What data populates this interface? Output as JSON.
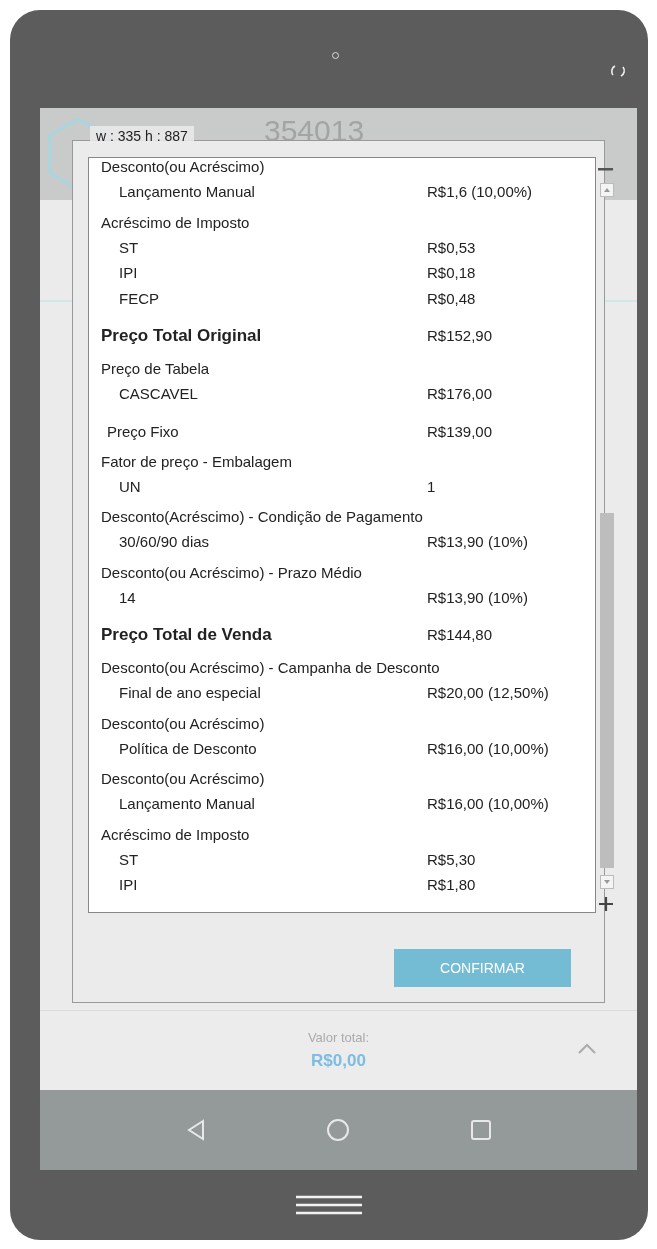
{
  "overlay_label": "w : 335  h : 887",
  "header": {
    "title": "354013"
  },
  "breakdown": [
    {
      "kind": "group",
      "title": "Desconto(ou Acréscimo)",
      "rows": [
        {
          "label": "Lançamento Manual",
          "value": "R$1,6 (10,00%)"
        }
      ]
    },
    {
      "kind": "group",
      "title": "Acréscimo de Imposto",
      "rows": [
        {
          "label": "ST",
          "value": "R$0,53"
        },
        {
          "label": "IPI",
          "value": "R$0,18"
        },
        {
          "label": "FECP",
          "value": "R$0,48"
        }
      ]
    },
    {
      "kind": "total",
      "label": "Preço Total Original",
      "value": "R$152,90"
    },
    {
      "kind": "group",
      "title": "Preço de Tabela",
      "rows": [
        {
          "label": "CASCAVEL",
          "value": "R$176,00"
        }
      ]
    },
    {
      "kind": "item",
      "label": "Preço Fixo",
      "value": "R$139,00"
    },
    {
      "kind": "group",
      "title": "Fator de preço - Embalagem",
      "rows": [
        {
          "label": "UN",
          "value": "1"
        }
      ]
    },
    {
      "kind": "group",
      "title": "Desconto(Acréscimo) - Condição de Pagamento",
      "rows": [
        {
          "label": "30/60/90 dias",
          "value": "R$13,90 (10%)"
        }
      ]
    },
    {
      "kind": "group",
      "title": "Desconto(ou Acréscimo) - Prazo Médio",
      "rows": [
        {
          "label": "14",
          "value": "R$13,90 (10%)"
        }
      ]
    },
    {
      "kind": "total",
      "label": "Preço Total de Venda",
      "value": "R$144,80"
    },
    {
      "kind": "group",
      "title": "Desconto(ou Acréscimo) - Campanha de Desconto",
      "rows": [
        {
          "label": "Final de ano especial",
          "value": "R$20,00 (12,50%)"
        }
      ]
    },
    {
      "kind": "group",
      "title": "Desconto(ou Acréscimo)",
      "rows": [
        {
          "label": "Política de Desconto",
          "value": "R$16,00 (10,00%)"
        }
      ]
    },
    {
      "kind": "group",
      "title": "Desconto(ou Acréscimo)",
      "rows": [
        {
          "label": "Lançamento Manual",
          "value": "R$16,00 (10,00%)"
        }
      ]
    },
    {
      "kind": "group",
      "title": "Acréscimo de Imposto",
      "rows": [
        {
          "label": "ST",
          "value": "R$5,30"
        },
        {
          "label": "IPI",
          "value": "R$1,80"
        }
      ]
    }
  ],
  "confirm_button": "CONFIRMAR",
  "footer": {
    "total_label": "Valor total:",
    "total_value": "R$0,00"
  }
}
